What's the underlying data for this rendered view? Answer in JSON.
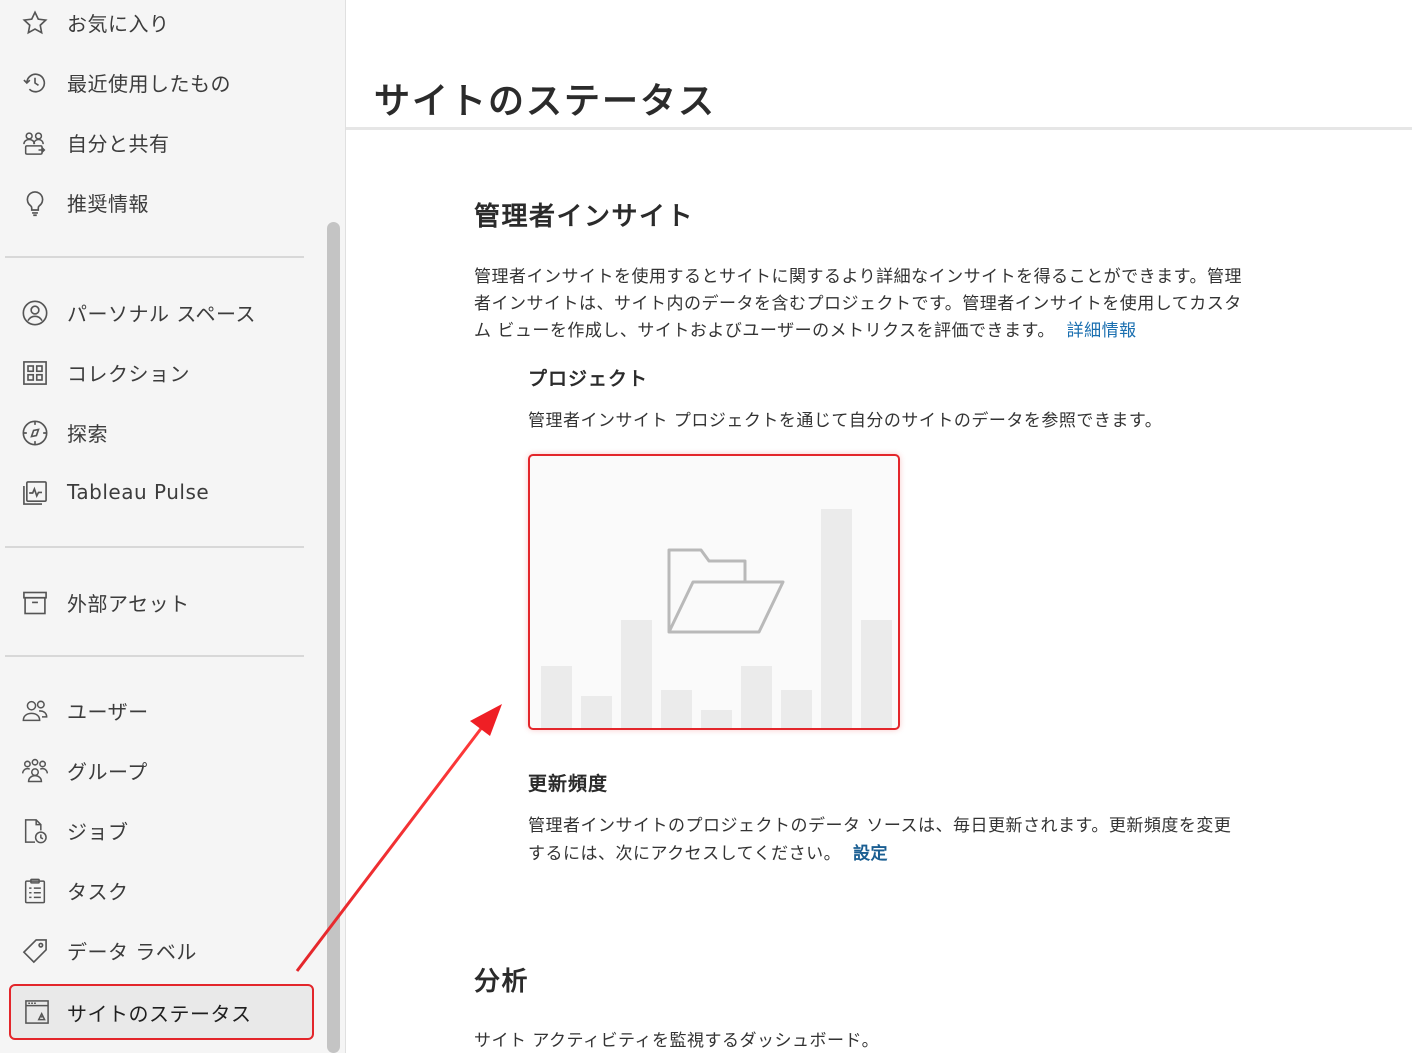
{
  "sidebar": {
    "items": [
      {
        "label": "お気に入り",
        "icon": "star-icon"
      },
      {
        "label": "最近使用したもの",
        "icon": "history-icon"
      },
      {
        "label": "自分と共有",
        "icon": "shared-users-icon"
      },
      {
        "label": "推奨情報",
        "icon": "lightbulb-icon"
      },
      {
        "label": "パーソナル スペース",
        "icon": "user-circle-icon"
      },
      {
        "label": "コレクション",
        "icon": "collection-icon"
      },
      {
        "label": "探索",
        "icon": "compass-icon"
      },
      {
        "label": "Tableau Pulse",
        "icon": "pulse-icon"
      },
      {
        "label": "外部アセット",
        "icon": "archive-box-icon"
      },
      {
        "label": "ユーザー",
        "icon": "users-icon"
      },
      {
        "label": "グループ",
        "icon": "group-icon"
      },
      {
        "label": "ジョブ",
        "icon": "job-clock-icon"
      },
      {
        "label": "タスク",
        "icon": "task-list-icon"
      },
      {
        "label": "データ ラベル",
        "icon": "tag-icon"
      },
      {
        "label": "サイトのステータス",
        "icon": "site-status-icon"
      }
    ],
    "active_index": 14,
    "highlight_color": "#e3262b"
  },
  "main": {
    "page_title": "サイトのステータス",
    "admin_insights": {
      "heading": "管理者インサイト",
      "description": "管理者インサイトを使用するとサイトに関するより詳細なインサイトを得ることができます。管理者インサイトは、サイト内のデータを含むプロジェクトです。管理者インサイトを使用してカスタム ビューを作成し、サイトおよびユーザーのメトリクスを評価できます。",
      "learn_more_link": "詳細情報",
      "project": {
        "heading": "プロジェクト",
        "description": "管理者インサイト プロジェクトを通じて自分のサイトのデータを参照できます。",
        "card_icon": "open-folder-icon"
      },
      "refresh": {
        "heading": "更新頻度",
        "description": "管理者インサイトのプロジェクトのデータ ソースは、毎日更新されます。更新頻度を変更するには、次にアクセスしてください。",
        "settings_link": "設定"
      }
    },
    "analysis": {
      "heading": "分析",
      "description": "サイト アクティビティを監視するダッシュボード。"
    }
  },
  "annotation": {
    "arrow_color": "#e3262b"
  }
}
